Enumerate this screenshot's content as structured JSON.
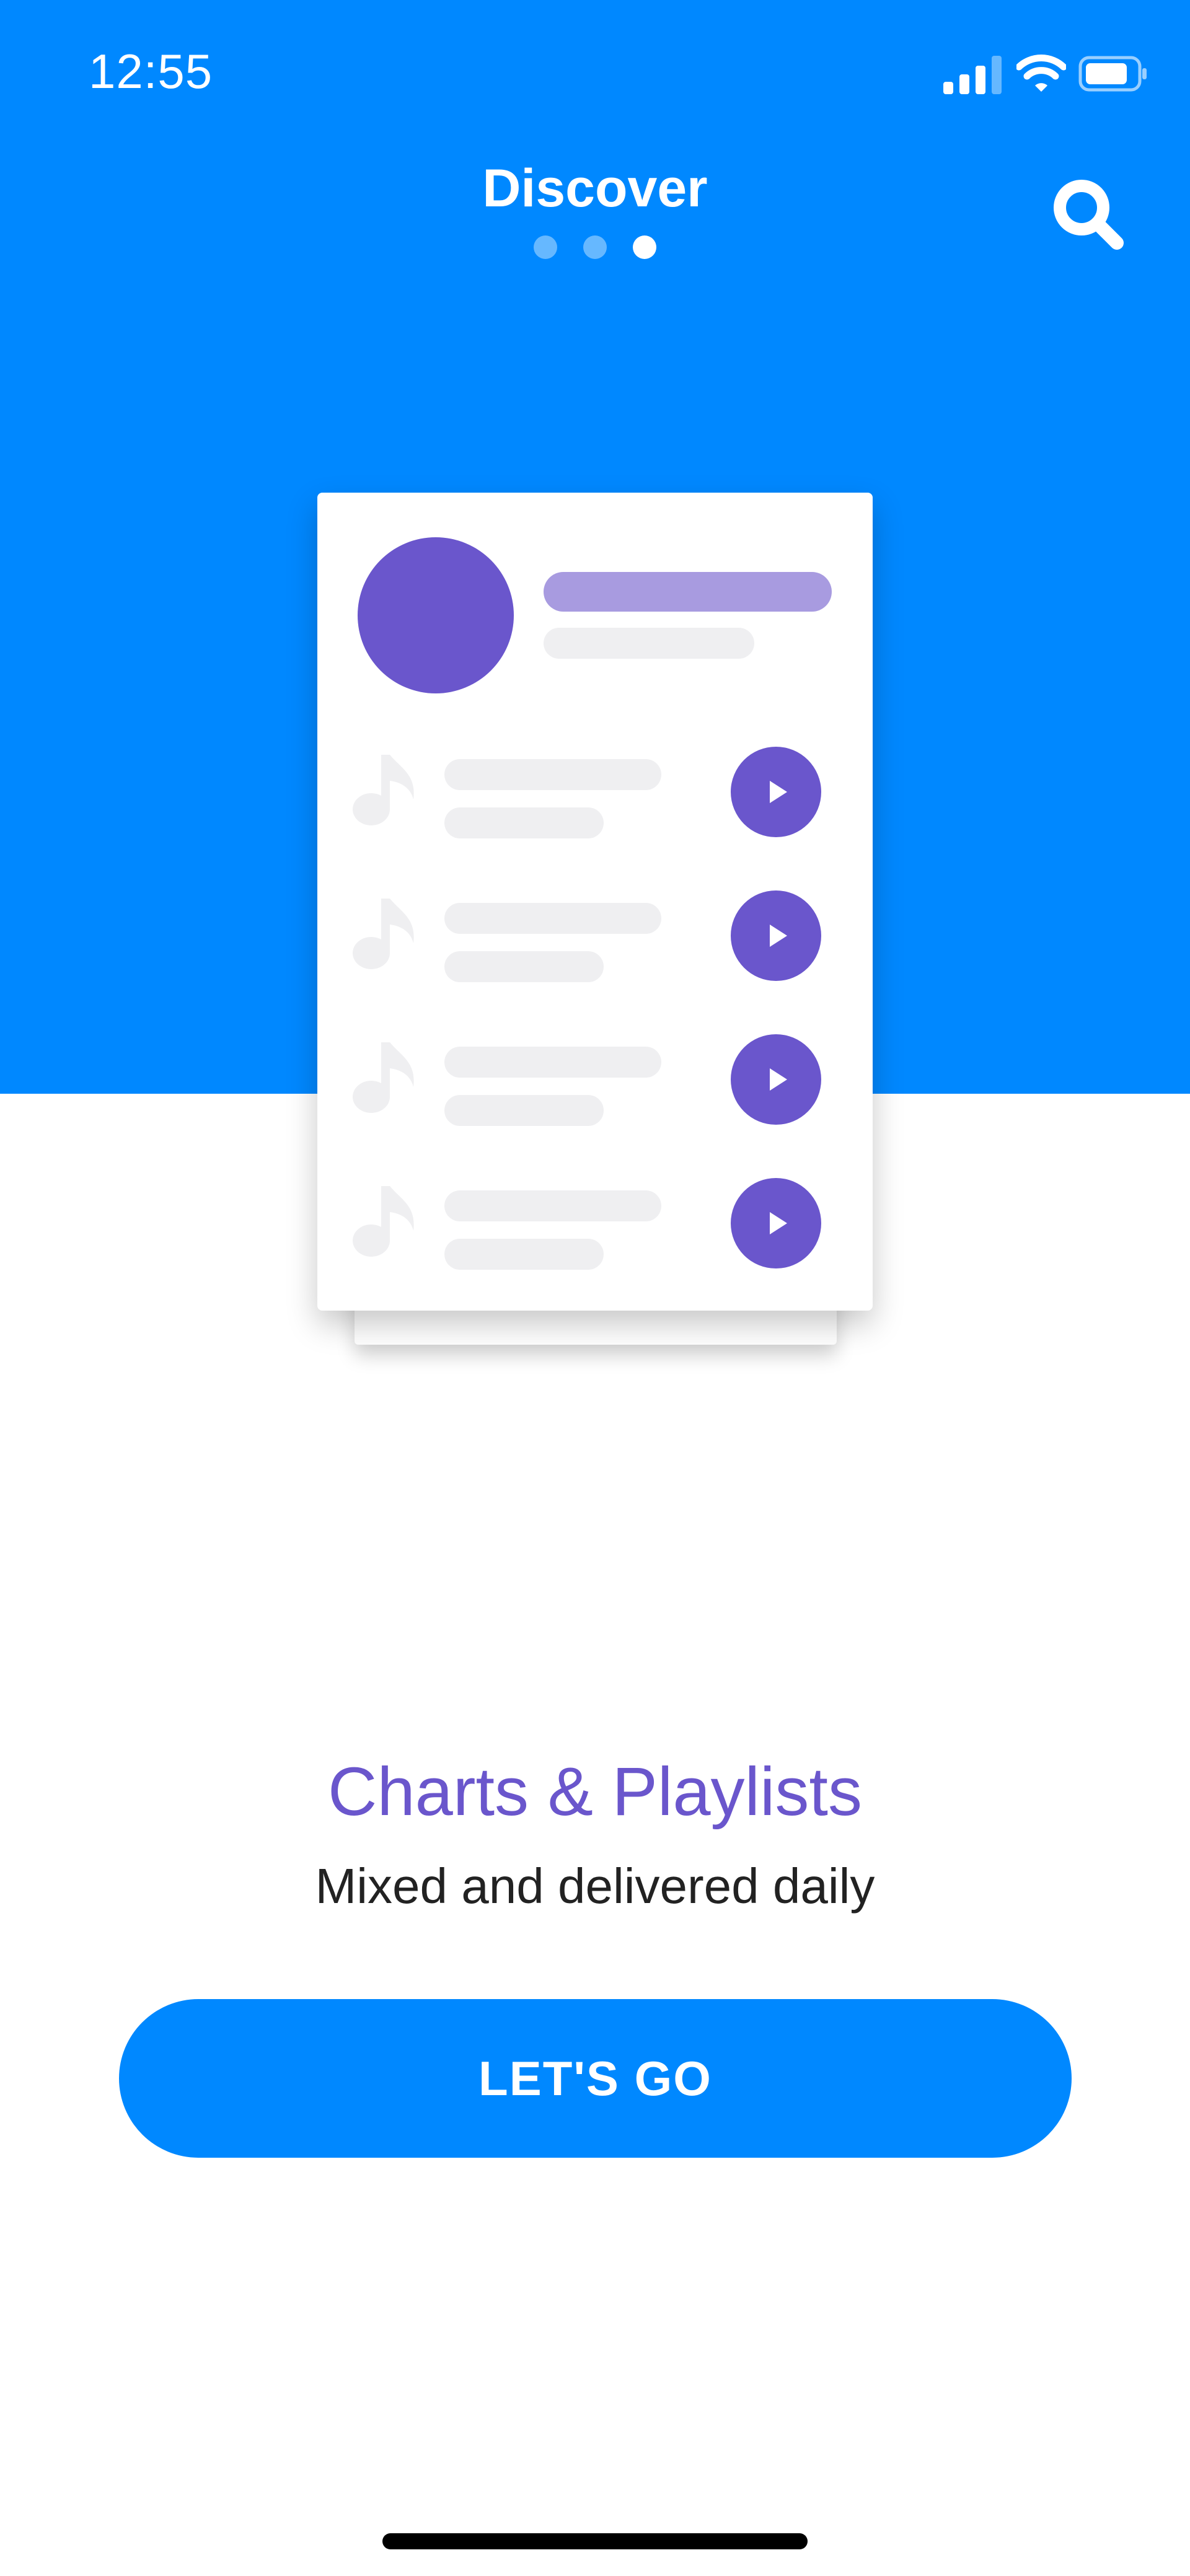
{
  "status_bar": {
    "time": "12:55",
    "icons": [
      "signal-icon",
      "wifi-icon",
      "battery-icon"
    ]
  },
  "header": {
    "title": "Discover",
    "page_indicator": {
      "count": 3,
      "active_index": 2
    },
    "search_icon": "search-icon"
  },
  "illustration": {
    "track_count": 4,
    "track_icon": "music-note-icon",
    "play_icon": "play-icon"
  },
  "onboarding": {
    "headline": "Charts & Playlists",
    "subheadline": "Mixed and delivered daily",
    "cta_label": "LET'S GO"
  },
  "colors": {
    "primary_blue": "#0088ff",
    "accent_purple": "#6a56cc",
    "light_purple": "#a89be0",
    "placeholder_gray": "#efeff1",
    "background": "#ffffff"
  }
}
